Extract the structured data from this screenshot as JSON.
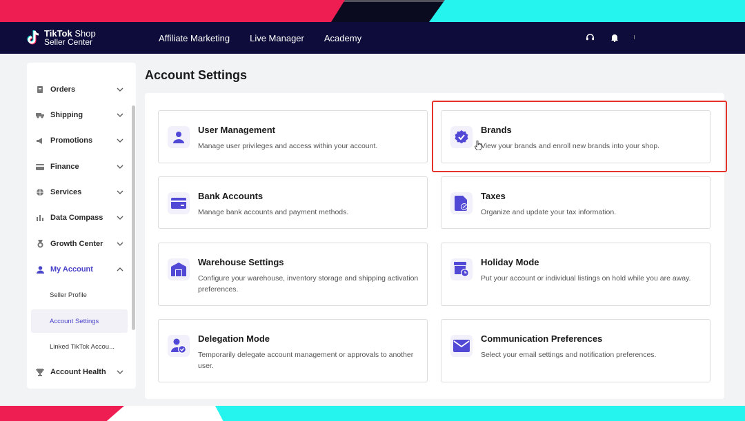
{
  "header": {
    "brand_line1": "TikTok",
    "brand_line1_suffix": " Shop",
    "brand_line2": "Seller Center",
    "nav": [
      "Affiliate Marketing",
      "Live Manager",
      "Academy"
    ],
    "icons": [
      "headset-icon",
      "bell-icon"
    ]
  },
  "sidebar": {
    "items": [
      {
        "label": "Orders",
        "icon": "orders-icon"
      },
      {
        "label": "Shipping",
        "icon": "truck-icon"
      },
      {
        "label": "Promotions",
        "icon": "megaphone-icon"
      },
      {
        "label": "Finance",
        "icon": "card-icon"
      },
      {
        "label": "Services",
        "icon": "globe-icon"
      },
      {
        "label": "Data Compass",
        "icon": "bar-chart-icon"
      },
      {
        "label": "Growth Center",
        "icon": "medal-icon"
      },
      {
        "label": "My Account",
        "icon": "user-icon",
        "expanded": true
      },
      {
        "label": "Account Health",
        "icon": "trophy-icon"
      }
    ],
    "sub_items": [
      "Seller Profile",
      "Account Settings",
      "Linked TikTok Accou..."
    ],
    "selected_sub_item": "Account Settings"
  },
  "main": {
    "title": "Account Settings",
    "cards": [
      {
        "title": "User Management",
        "desc": "Manage user privileges and access within your account.",
        "icon": "user-icon"
      },
      {
        "title": "Brands",
        "desc": "View your brands and enroll new brands into your shop.",
        "icon": "verified-badge-icon"
      },
      {
        "title": "Bank Accounts",
        "desc": "Manage bank accounts and payment methods.",
        "icon": "credit-card-icon"
      },
      {
        "title": "Taxes",
        "desc": "Organize and update your tax information.",
        "icon": "tax-document-icon"
      },
      {
        "title": "Warehouse Settings",
        "desc": "Configure your warehouse, inventory storage and shipping activation preferences.",
        "icon": "warehouse-icon"
      },
      {
        "title": "Holiday Mode",
        "desc": "Put your account or individual listings on hold while you are away.",
        "icon": "store-clock-icon"
      },
      {
        "title": "Delegation Mode",
        "desc": "Temporarily delegate account management or approvals to another user.",
        "icon": "user-check-icon"
      },
      {
        "title": "Communication Preferences",
        "desc": "Select your email settings and notification preferences.",
        "icon": "mail-icon"
      }
    ],
    "highlighted_card": "Brands"
  },
  "colors": {
    "header_bg": "#0e0c3a",
    "accent": "#4b45c9",
    "highlight_border": "#e5322b",
    "tiktok_red": "#ee1d52",
    "tiktok_cyan": "#25f4ee"
  }
}
